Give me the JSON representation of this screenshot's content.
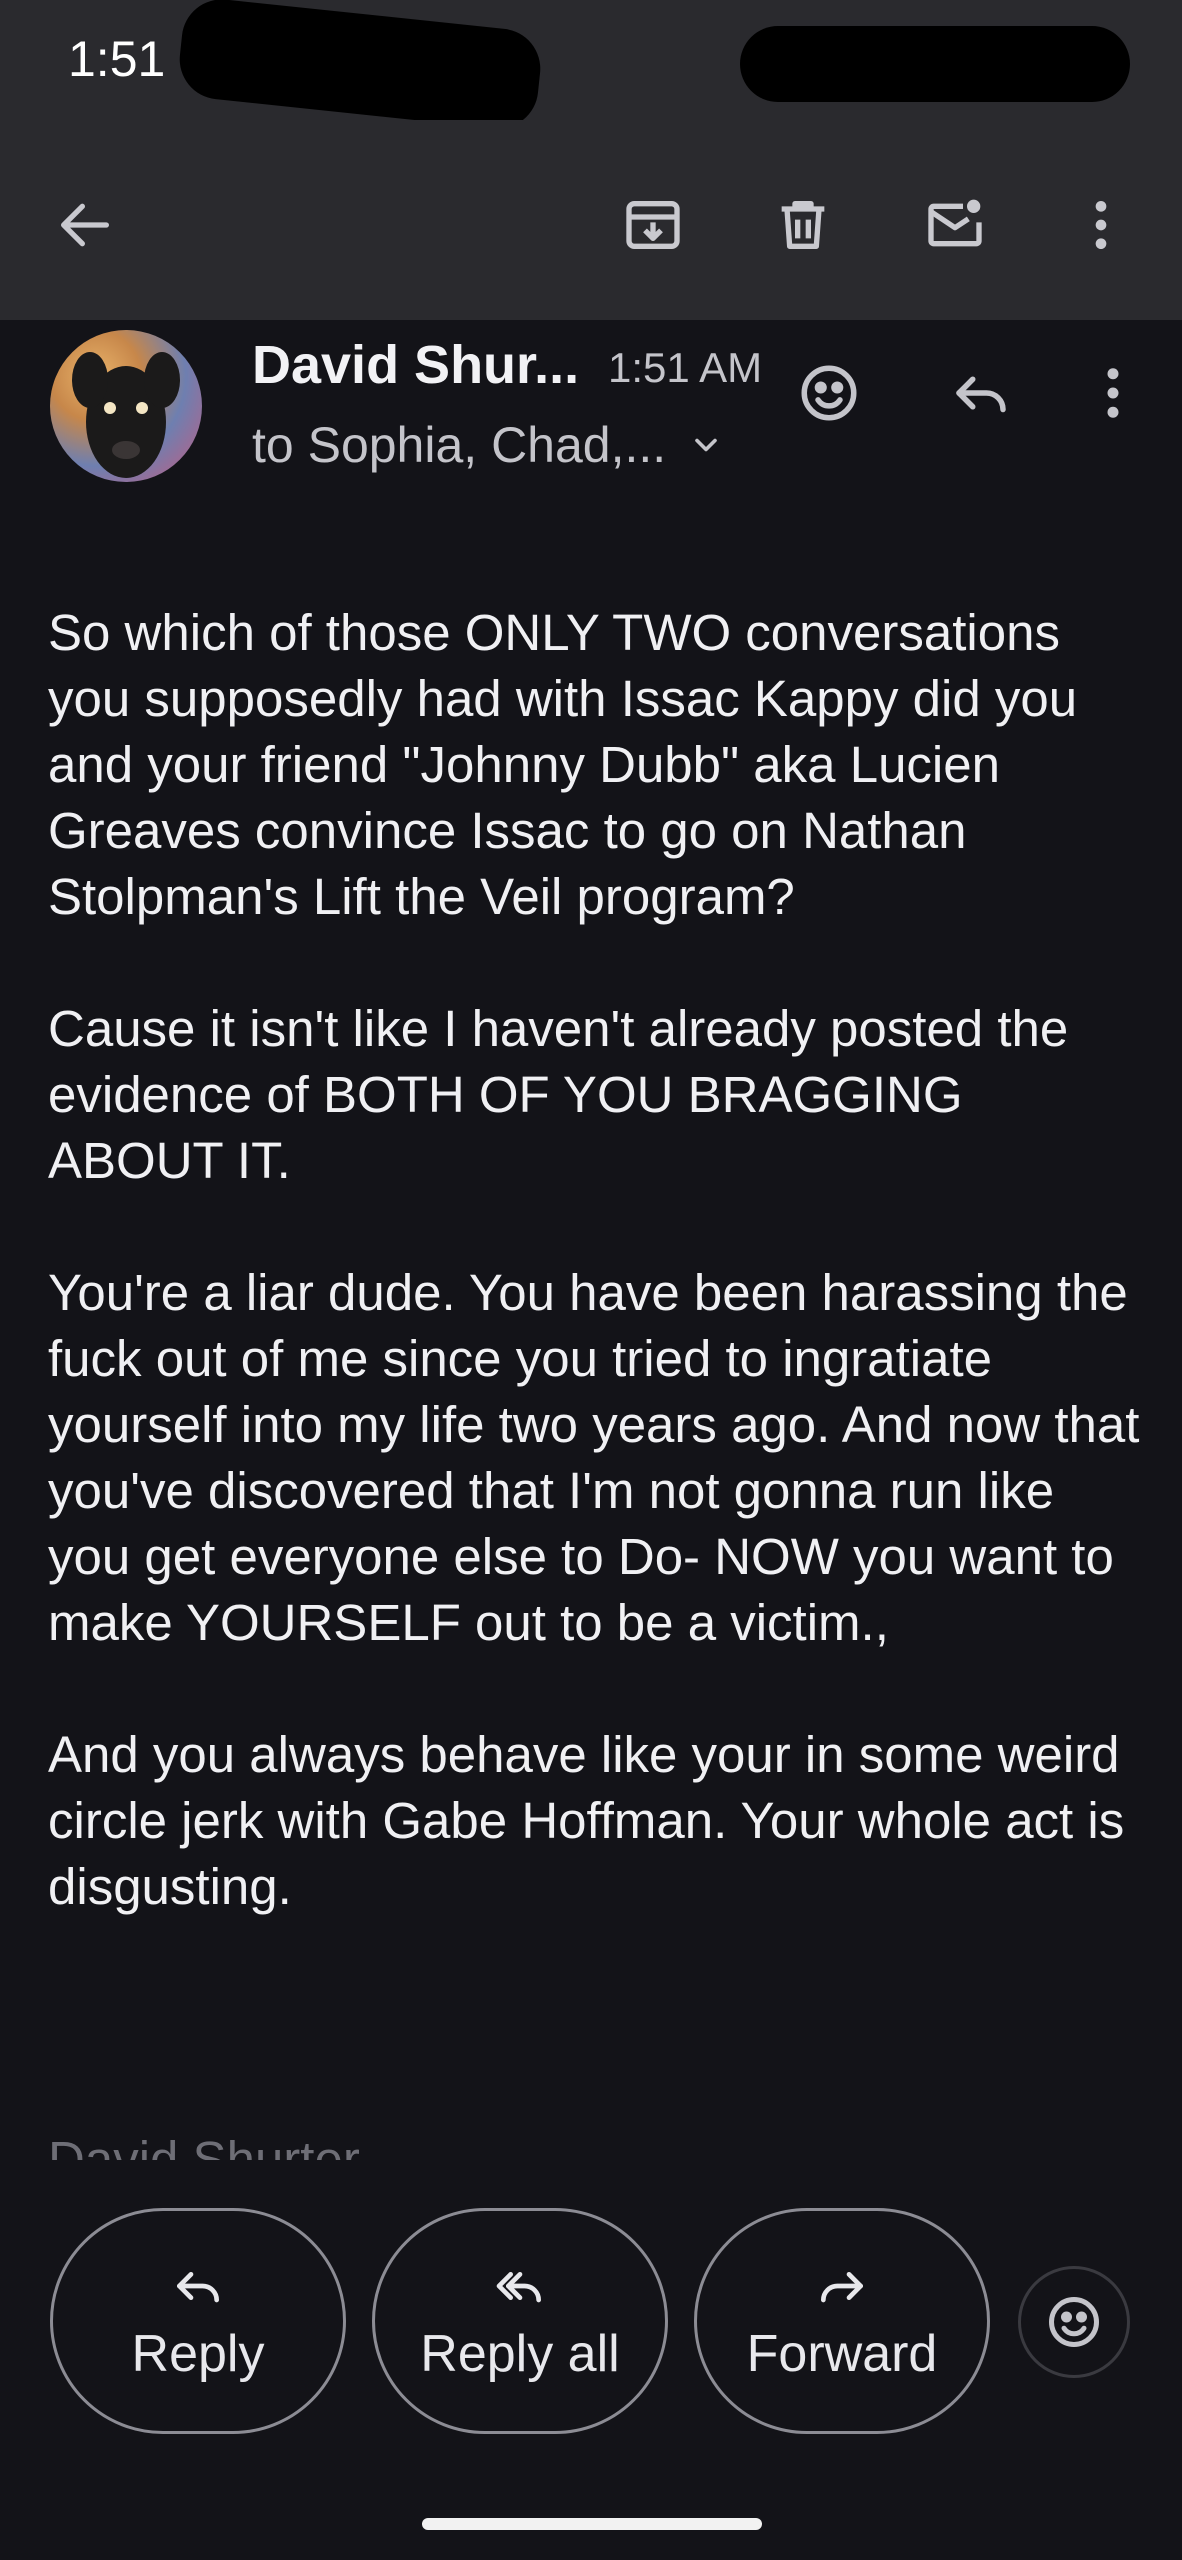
{
  "status_bar": {
    "time": "1:51"
  },
  "toolbar": {
    "back": "back-arrow-icon",
    "archive": "archive-icon",
    "delete": "trash-icon",
    "mark_unread": "mark-unread-icon",
    "more": "more-vert-icon"
  },
  "message": {
    "sender": "David Shur...",
    "time": "1:51 AM",
    "recipients": "to Sophia, Chad,...",
    "paragraphs": [
      "So which of those ONLY TWO conversations you supposedly had with Issac Kappy did you and your friend \"Johnny Dubb\" aka Lucien Greaves convince Issac to go on Nathan Stolpman's Lift the Veil program?",
      "Cause it isn't like I haven't already posted the evidence of BOTH OF YOU BRAGGING ABOUT IT.",
      "You're a liar dude. You have been harassing the fuck out of me since you tried to ingratiate yourself into my life two years ago. And now that you've discovered that I'm not gonna run like you get everyone else to Do- NOW you want to make YOURSELF out to be a victim.,",
      "And you always behave like your in some weird circle jerk with Gabe Hoffman. Your whole act is disgusting."
    ],
    "signature": "David Shurter"
  },
  "actions": {
    "reply": "Reply",
    "reply_all": "Reply all",
    "forward": "Forward"
  },
  "colors": {
    "background": "#131318",
    "toolbar": "#2a2a2e",
    "text": "#f0f0f3",
    "muted": "#c4c4ca",
    "outline": "#8c8c94"
  }
}
